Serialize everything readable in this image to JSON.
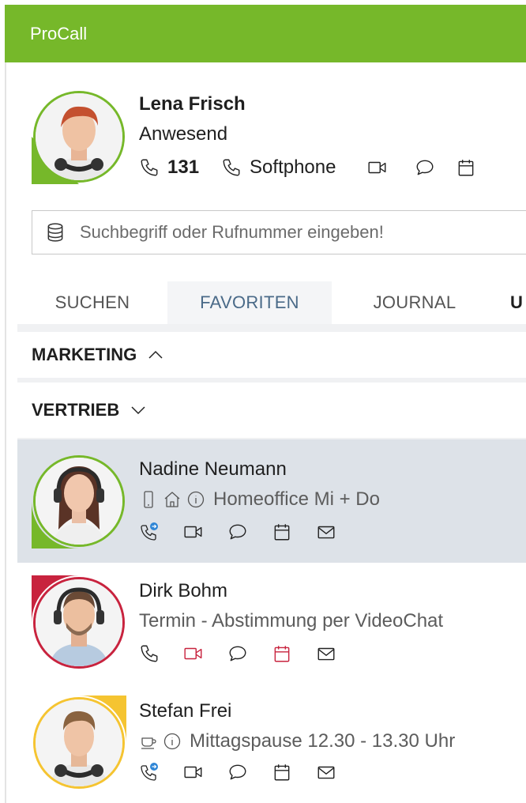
{
  "app": {
    "title": "ProCall"
  },
  "me": {
    "name": "Lena Frisch",
    "presence": "Anwesend",
    "presence_color": "#76b82a",
    "extension": "131",
    "device": "Softphone"
  },
  "search": {
    "placeholder": "Suchbegriff oder Rufnummer eingeben!"
  },
  "tabs": [
    {
      "label": "SUCHEN"
    },
    {
      "label": "FAVORITEN",
      "active": true
    },
    {
      "label": "JOURNAL"
    },
    {
      "label": "U"
    }
  ],
  "groups": [
    {
      "label": "MARKETING",
      "expanded": true
    },
    {
      "label": "VERTRIEB",
      "expanded": false
    }
  ],
  "contacts": [
    {
      "name": "Nadine Neumann",
      "status": "Homeoffice Mi + Do",
      "presence_color": "#76b82a",
      "selected": true,
      "status_icons": [
        "mobile-icon",
        "home-icon",
        "info-icon"
      ]
    },
    {
      "name": "Dirk Bohm",
      "status": "Termin - Abstimmung per VideoChat",
      "presence_color": "#c8233e",
      "selected": false,
      "status_icons": []
    },
    {
      "name": "Stefan Frei",
      "status": "Mittagspause 12.30 - 13.30 Uhr",
      "presence_color": "#f5c431",
      "selected": false,
      "status_icons": [
        "coffee-icon",
        "info-icon"
      ]
    }
  ],
  "colors": {
    "accent": "#76b82a",
    "busy": "#c8233e",
    "away": "#f5c431",
    "tab_active_text": "#4a6a88"
  }
}
